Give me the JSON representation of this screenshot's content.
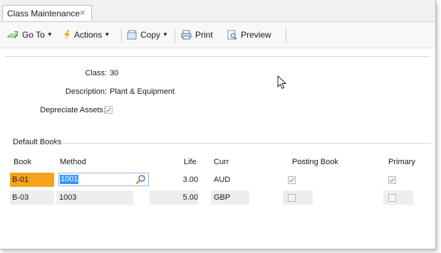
{
  "tab": {
    "label": "Class Maintenance",
    "close_glyph": "×"
  },
  "toolbar": {
    "goto_label": "Go To",
    "actions_label": "Actions",
    "copy_label": "Copy",
    "print_label": "Print",
    "preview_label": "Preview"
  },
  "form": {
    "class_label": "Class:",
    "class_value": "30",
    "description_label": "Description:",
    "description_value": "Plant & Equipment",
    "depreciate_label": "Depreciate Assets:",
    "depreciate_checked": true
  },
  "books": {
    "group_title": "Default Books",
    "columns": {
      "book": "Book",
      "method": "Method",
      "life": "Life",
      "curr": "Curr",
      "posting": "Posting Book",
      "primary": "Primary"
    },
    "rows": [
      {
        "book": "B-01",
        "method": "1001",
        "life": "3.00",
        "curr": "AUD",
        "posting": true,
        "primary": true
      },
      {
        "book": "B-03",
        "method": "1003",
        "life": "5.00",
        "curr": "GBP",
        "posting": false,
        "primary": false
      }
    ]
  },
  "colors": {
    "selected_row": "#f7a21c",
    "selection": "#3399ff"
  }
}
